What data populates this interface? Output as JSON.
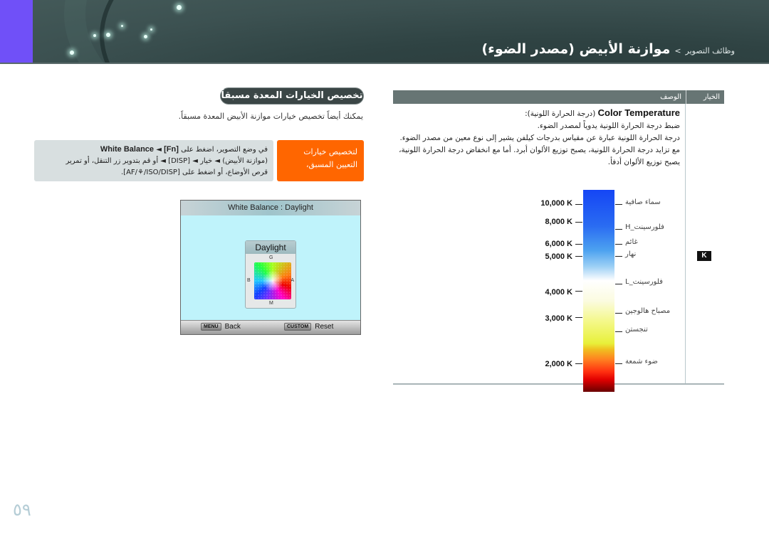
{
  "header": {
    "breadcrumb": "وظائف التصوير",
    "separator": ">",
    "title": "موازنة الأبيض (مصدر الضوء)"
  },
  "section": {
    "heading": "تخصيص الخيارات المعدة مسبقاً",
    "intro": "يمكنك أيضاً تخصيص خيارات موازنة الأبيض المعدة مسبقاً."
  },
  "tip": {
    "label": "لتخصيص خيارات التعيين المسبق،",
    "line1_prefix": "في وضع التصوير، اضغط على",
    "line1_key": "[Fn]",
    "line1_arrow": "◄",
    "line1_bold": "White Balance",
    "line2": "(موازنة الأبيض) ◄ خيار ◄ [DISP] ◄ أو قم بتدوير زر التنقل، أو تمرير",
    "line3": "قرص الأوضاع، أو اضغط على [AF/⚘/ISO/DISP]."
  },
  "camera_screen": {
    "title": "White Balance : Daylight",
    "panel_title": "Daylight",
    "axis_g": "G",
    "axis_m": "M",
    "axis_b": "B",
    "axis_a": "A",
    "back_key": "MENU",
    "back_label": "Back",
    "reset_key": "CUSTOM",
    "reset_label": "Reset"
  },
  "table": {
    "headers": {
      "option": "الخيار",
      "description": "الوصف"
    },
    "row": {
      "option_icon": "K",
      "title_en": "Color Temperature",
      "title_ar": "(درجة الحرارة اللونية):",
      "line1": "ضبط درجة الحرارة اللونية يدوياً لمصدر الضوء.",
      "line2": "درجة الحرارة اللونية عبارة عن مقياس بدرجات كيلفن يشير إلى نوع معين من مصدر الضوء. مع تزايد درجة الحرارة اللونية، يصبح توزيع الألوان أبرد. أما مع انخفاض درجة الحرارة اللونية، يصبح توزيع الألوان أدفأ."
    },
    "scale": {
      "kelvin": [
        "10,000 K",
        "8,000 K",
        "6,000 K",
        "5,000 K",
        "4,000 K",
        "3,000 K",
        "2,000 K"
      ],
      "sources": [
        "سماء صافية",
        "فلورسينت_H",
        "غائم",
        "نهار",
        "فلورسينت_L",
        "مصباح هالوجين",
        "تنجستن",
        "ضوء شمعة"
      ]
    }
  },
  "page_number": "٥٩"
}
